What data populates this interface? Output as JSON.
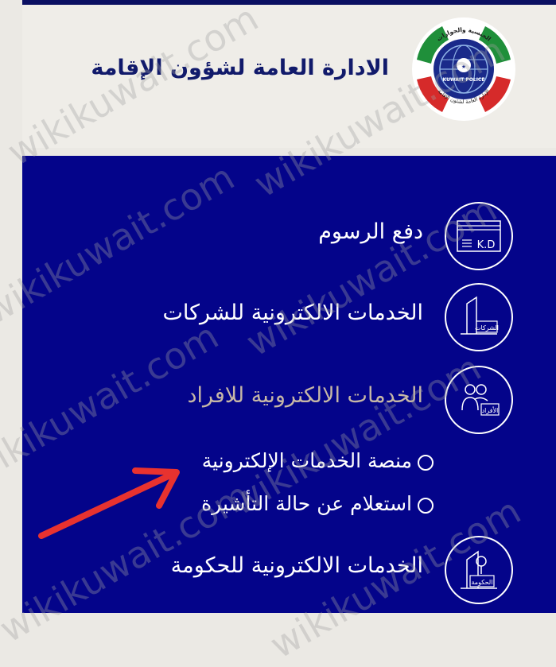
{
  "header": {
    "title": "الادارة العامة لشؤون الإقامة",
    "logo": {
      "top_text": "الجنسية والجوازات",
      "center_text": "KUWAIT POLICE",
      "bottom_text": "الإدارة العامة لشئون الإقامة"
    }
  },
  "services": [
    {
      "label": "دفع الرسوم",
      "icon": "kd-payment-icon",
      "icon_text": "K.D"
    },
    {
      "label": "الخدمات الالكترونية للشركات",
      "icon": "companies-building-icon",
      "icon_text": "الشركات"
    },
    {
      "label": "الخدمات الالكترونية للافراد",
      "icon": "individuals-people-icon",
      "icon_text": "الأفراد"
    },
    {
      "label": "الخدمات الالكترونية للحكومة",
      "icon": "government-building-icon",
      "icon_text": "الحكومة"
    }
  ],
  "individual_subitems": [
    {
      "label": "منصة الخدمات الإلكترونية"
    },
    {
      "label": "استعلام عن حالة التأشيرة"
    }
  ],
  "watermark": "wikikuwait.com",
  "colors": {
    "panel": "#04048a",
    "header_bg": "#efede8",
    "title": "#111a6b",
    "muted_label": "#c6b7a6",
    "arrow": "#e8322f"
  }
}
